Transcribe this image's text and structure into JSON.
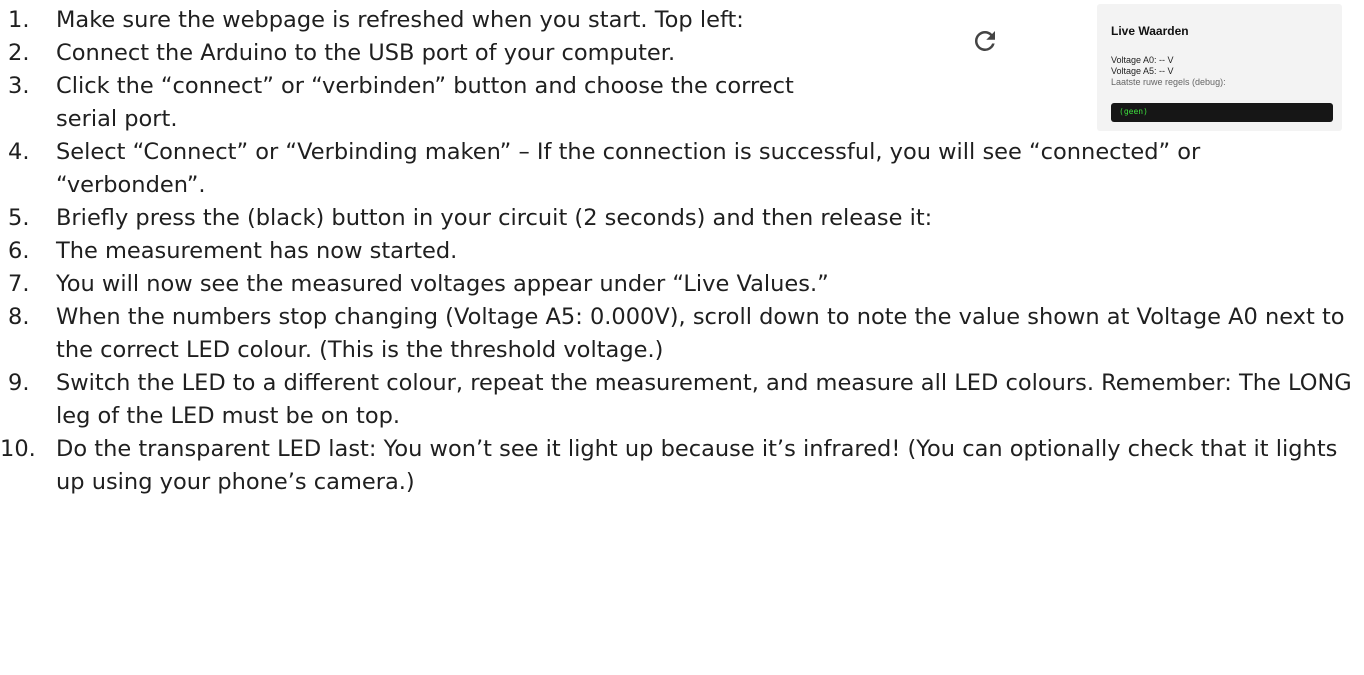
{
  "steps": [
    {
      "num": "1.",
      "text": "Make sure the webpage is refreshed when you start. Top left:"
    },
    {
      "num": "2.",
      "text": "Connect the Arduino to the USB port of your computer."
    },
    {
      "num": "3.",
      "text": "Click the “connect” or “verbinden” button and choose the correct serial port."
    },
    {
      "num": "4.",
      "text": "Select “Connect” or “Verbinding maken” – If the connection is successful, you will see “connected” or “verbonden”."
    },
    {
      "num": "5.",
      "text": "Briefly press the (black) button in your circuit (2 seconds) and then release it:"
    },
    {
      "num": "6.",
      "text": "The measurement has now started."
    },
    {
      "num": "7.",
      "text": "You will now see the measured voltages appear under “Live Values.”"
    },
    {
      "num": "8.",
      "text": "When the numbers stop changing (Voltage A5: 0.000V), scroll down to note the value shown at Voltage A0 next to the correct LED colour. (This is the threshold voltage.)"
    },
    {
      "num": "9.",
      "text": "Switch the LED to a different colour, repeat the measurement, and measure all LED colours. Remember: The LONG leg of the LED must be on top."
    },
    {
      "num": "10.",
      "text": "Do the transparent LED last: You won’t see it light up because it’s infrared! (You can optionally check that it lights up using your phone’s camera.)"
    }
  ],
  "refresh_icon": "refresh-icon",
  "live_panel": {
    "title": "Live Waarden",
    "voltage_a0": "Voltage A0: -- V",
    "voltage_a5": "Voltage A5: -- V",
    "debug_label": "Laatste ruwe regels (debug):",
    "debug_output": "(geen)"
  },
  "colors": {
    "text": "#1f1f1f",
    "panel_bg": "#f3f3f3",
    "debug_bg": "#161616",
    "debug_text": "#3ddc3d"
  }
}
